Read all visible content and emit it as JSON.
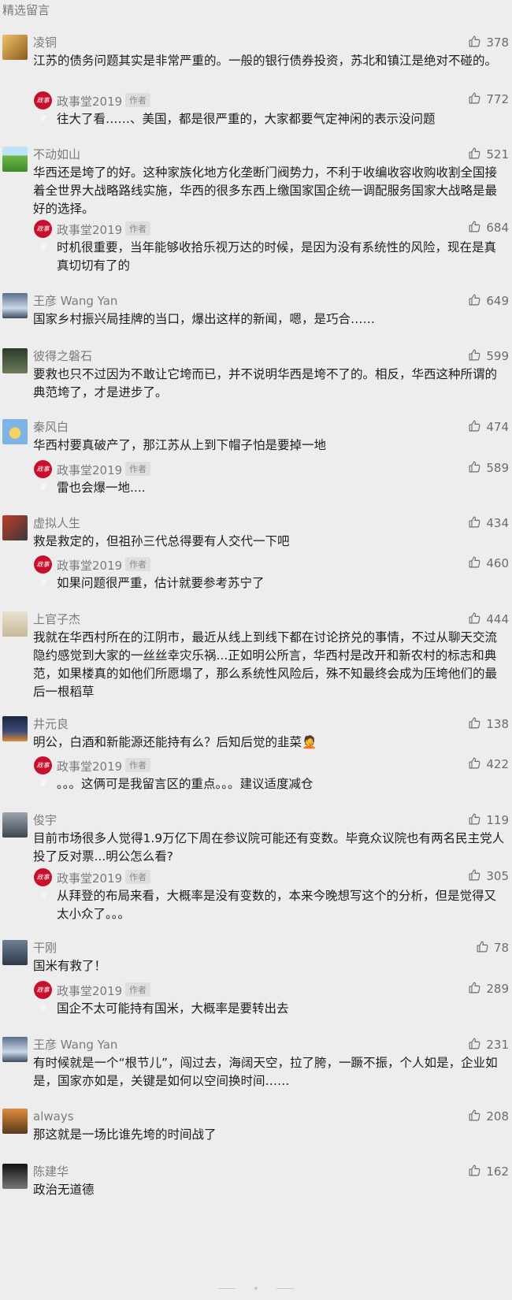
{
  "section_title": "精选留言",
  "reply_author_tag": "作者",
  "comments": [
    {
      "name": "凌铜",
      "likes": "378",
      "text": "江苏的债务问题其实是非常严重的。一般的银行债券投资，苏北和镇江是绝对不碰的。",
      "avatar": "avatar-gold",
      "reply": {
        "name": "政事堂2019",
        "likes": "772",
        "text": "往大了看……、美国，都是很严重的，大家都要气定神闲的表示没问题"
      }
    },
    {
      "name": "不动如山",
      "likes": "521",
      "text": "华西还是垮了的好。这种家族化地方化垄断门阀势力，不利于收编收容收购收割全国接着全世界大战略路线实施，华西的很多东西上缴国家国企统一调配服务国家大战略是最好的选择。",
      "avatar": "avatar-field",
      "reply": {
        "name": "政事堂2019",
        "likes": "684",
        "text": "时机很重要，当年能够收拾乐视万达的时候，是因为没有系统性的风险，现在是真真切切有了的"
      }
    },
    {
      "name": "王彦 Wang Yan",
      "likes": "649",
      "text": "国家乡村振兴局挂牌的当口，爆出这样的新闻，嗯，是巧合……",
      "avatar": "avatar-sky"
    },
    {
      "name": "彼得之磐石",
      "likes": "599",
      "text": "要救也只不过因为不敢让它垮而已，并不说明华西是垮不了的。相反，华西这种所谓的典范垮了，才是进步了。",
      "avatar": "avatar-dark"
    },
    {
      "name": "秦风白",
      "likes": "474",
      "text": "华西村要真破产了，那江苏从上到下帽子怕是要掉一地",
      "avatar": "avatar-cartoon",
      "reply": {
        "name": "政事堂2019",
        "likes": "589",
        "text": "雷也会爆一地...."
      }
    },
    {
      "name": "虚拟人生",
      "likes": "434",
      "text": "救是救定的，但祖孙三代总得要有人交代一下吧",
      "avatar": "avatar-red",
      "reply": {
        "name": "政事堂2019",
        "likes": "460",
        "text": "如果问题很严重，估计就要参考苏宁了"
      }
    },
    {
      "name": "上官子杰",
      "likes": "444",
      "text": "我就在华西村所在的江阴市，最近从线上到线下都在讨论挤兑的事情，不过从聊天交流隐约感觉到大家的一丝丝幸灾乐祸...正如明公所言，华西村是改开和新农村的标志和典范，如果楼真的如他们所愿塌了，那么系统性风险后，殊不知最终会成为压垮他们的最后一根稻草",
      "avatar": "avatar-beige"
    },
    {
      "name": "井元良",
      "likes": "138",
      "text": "明公，白酒和新能源还能持有么？后知后觉的韭菜🤦",
      "avatar": "avatar-night",
      "reply": {
        "name": "政事堂2019",
        "likes": "422",
        "text": "。。。这俩可是我留言区的重点。。。建议适度减仓"
      }
    },
    {
      "name": "俊宇",
      "likes": "119",
      "text": "目前市场很多人觉得1.9万亿下周在参议院可能还有变数。毕竟众议院也有两名民主党人投了反对票...明公怎么看?",
      "avatar": "avatar-person",
      "reply": {
        "name": "政事堂2019",
        "likes": "305",
        "text": "从拜登的布局来看，大概率是没有变数的，本来今晚想写这个的分析，但是觉得又太小众了。。。"
      }
    },
    {
      "name": "干刚",
      "likes": "78",
      "text": "国米有救了！",
      "avatar": "avatar-canal",
      "reply": {
        "name": "政事堂2019",
        "likes": "289",
        "text": "国企不太可能持有国米，大概率是要转出去"
      }
    },
    {
      "name": "王彦 Wang Yan",
      "likes": "231",
      "text": "有时候就是一个“根节儿”，闯过去，海阔天空，拉了胯，一蹶不振，个人如是，企业如是，国家亦如是，关键是如何以空间换时间……",
      "avatar": "avatar-sky"
    },
    {
      "name": "always",
      "likes": "208",
      "text": "那这就是一场比谁先垮的时间战了",
      "avatar": "avatar-sunset"
    },
    {
      "name": "陈建华",
      "likes": "162",
      "text": "政治无道德",
      "avatar": "avatar-bw"
    }
  ]
}
